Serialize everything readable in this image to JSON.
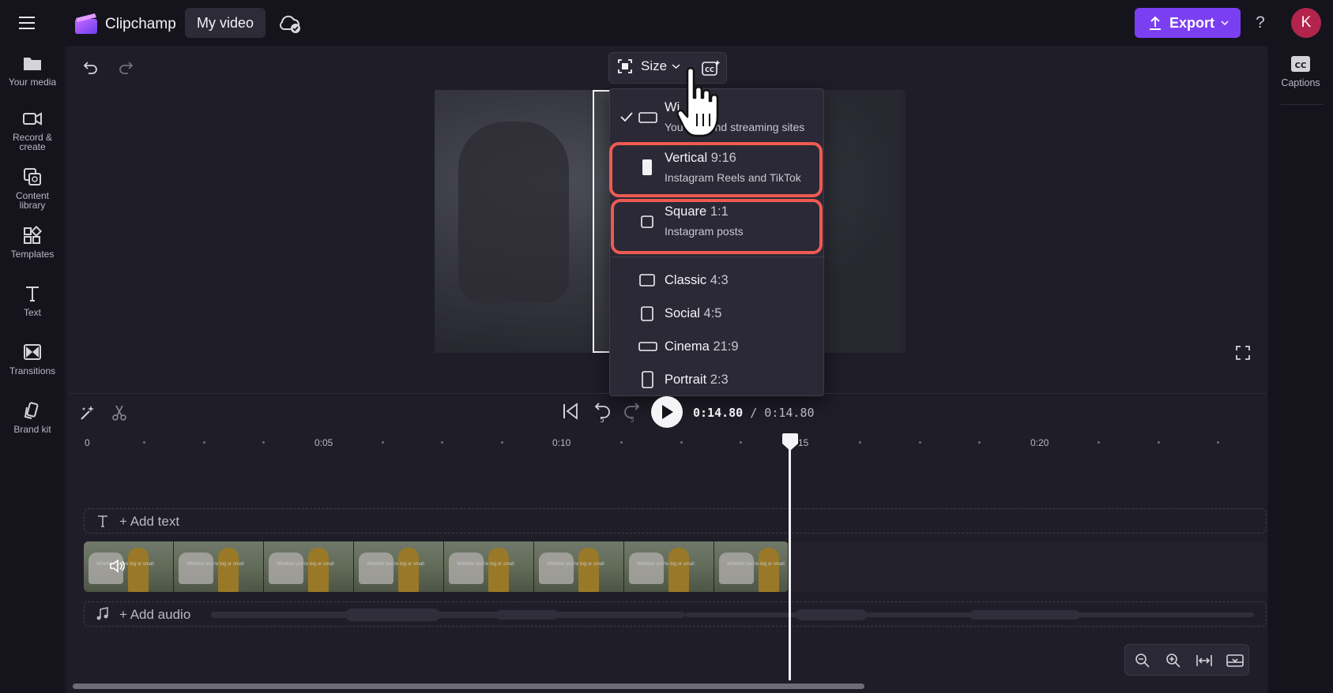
{
  "app": {
    "name": "Clipchamp",
    "project_title": "My video",
    "export_label": "Export",
    "help_label": "?",
    "avatar_initial": "K"
  },
  "sidebar": {
    "items": [
      {
        "label": "Your media",
        "icon": "folder-icon"
      },
      {
        "label": "Record &",
        "label2": "create",
        "icon": "camera-icon"
      },
      {
        "label": "Content",
        "label2": "library",
        "icon": "content-library-icon"
      },
      {
        "label": "Templates",
        "icon": "templates-icon"
      },
      {
        "label": "Text",
        "icon": "text-icon"
      },
      {
        "label": "Transitions",
        "icon": "transitions-icon"
      },
      {
        "label": "Brand kit",
        "icon": "brand-kit-icon"
      }
    ]
  },
  "right_sidebar": {
    "captions_label": "Captions"
  },
  "toolbar": {
    "size_label": "Size"
  },
  "size_menu": {
    "items": [
      {
        "title": "Wi",
        "ratio": "",
        "subtitle": "You",
        "subtitle_end": "nd streaming sites",
        "selected": true
      },
      {
        "title": "Vertical",
        "ratio": "9:16",
        "subtitle": "Instagram Reels and TikTok",
        "highlighted": true
      },
      {
        "title": "Square",
        "ratio": "1:1",
        "subtitle": "Instagram posts",
        "highlighted": true
      },
      {
        "title": "Classic",
        "ratio": "4:3"
      },
      {
        "title": "Social",
        "ratio": "4:5"
      },
      {
        "title": "Cinema",
        "ratio": "21:9"
      },
      {
        "title": "Portrait",
        "ratio": "2:3"
      }
    ]
  },
  "playback": {
    "current_time": "0:14.80",
    "total_time": "/ 0:14.80",
    "skip_back_label": "5",
    "skip_forward_label": "5"
  },
  "timeline": {
    "ruler": [
      "0",
      "0:05",
      "0:10",
      "15",
      "0:20"
    ],
    "add_text_label": "+ Add text",
    "add_audio_label": "+ Add audio",
    "clip_caption": "Whether you're big or small"
  },
  "colors": {
    "accent": "#7b3ff2",
    "highlight": "#ee5a52",
    "avatar": "#b3244c"
  }
}
